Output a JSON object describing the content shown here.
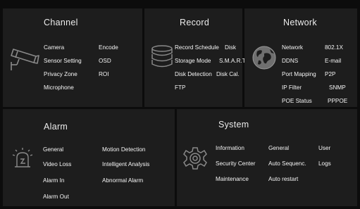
{
  "channel": {
    "title": "Channel",
    "items": [
      "Camera",
      "Encode",
      "Sensor Setting",
      "OSD",
      "Privacy Zone",
      "ROI",
      "Microphone"
    ]
  },
  "record": {
    "title": "Record",
    "items": [
      "Record Schedule",
      "Disk",
      "Storage Mode",
      "S.M.A.R.T.",
      "Disk Detection",
      "Disk Cal.",
      "FTP"
    ]
  },
  "network": {
    "title": "Network",
    "items": [
      "Network",
      "802.1X",
      "DDNS",
      "E-mail",
      "Port Mapping",
      "P2P",
      "IP Filter",
      "SNMP",
      "POE Status",
      "PPPOE"
    ],
    "more": "..."
  },
  "alarm": {
    "title": "Alarm",
    "items": [
      "General",
      "Motion Detection",
      "Video Loss",
      "Intelligent Analysis",
      "Alarm In",
      "Abnormal Alarm",
      "Alarm Out"
    ]
  },
  "system": {
    "title": "System",
    "items": [
      "Information",
      "General",
      "User",
      "Security Center",
      "Auto Sequenc.",
      "Logs",
      "Maintenance",
      "Auto restart"
    ]
  },
  "icons": {
    "channel": "security-camera-icon",
    "record": "hard-disk-stack-icon",
    "network": "globe-icon",
    "alarm": "alarm-siren-icon",
    "system": "gear-icon"
  },
  "colors": {
    "panel_bg": "#1d1d1d",
    "background": "#0c0c0c",
    "text": "#f5f5f5",
    "icon": "#8a8a8a"
  }
}
